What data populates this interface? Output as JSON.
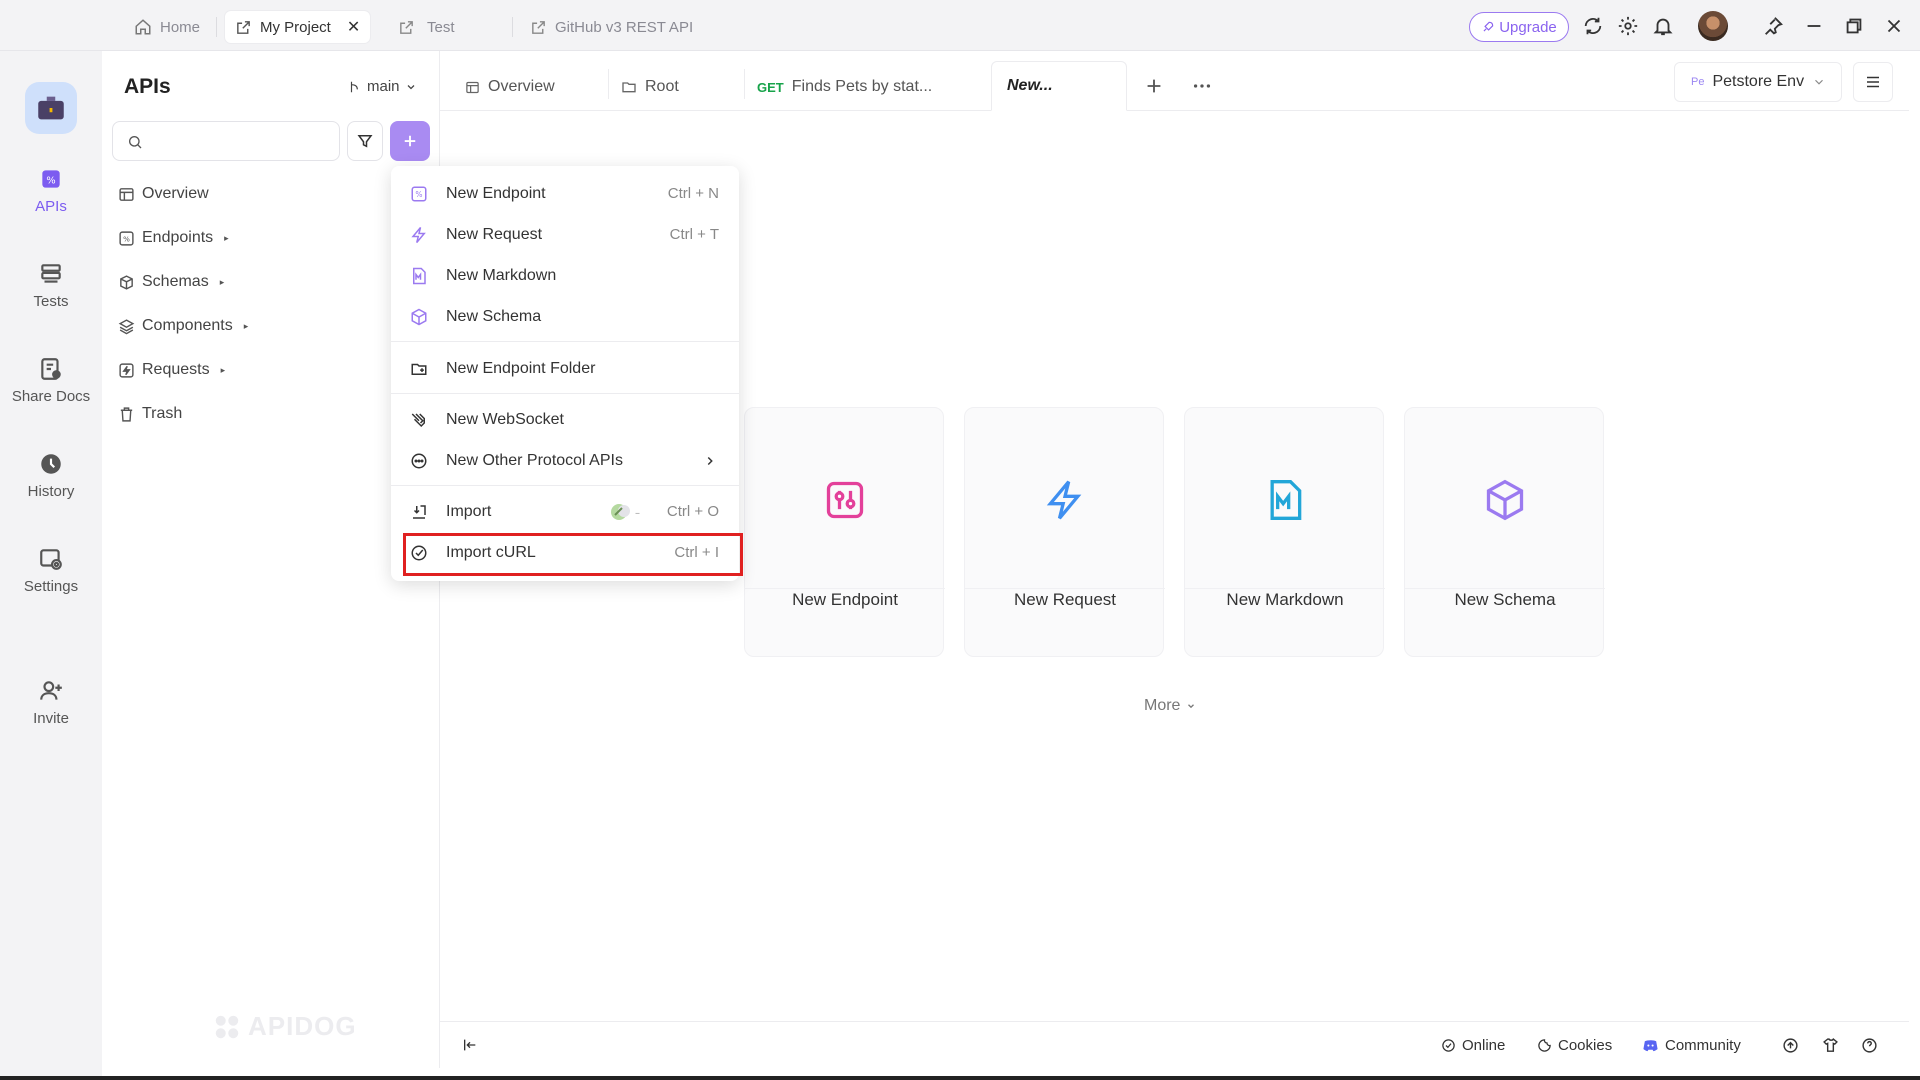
{
  "topbar": {
    "tabs": [
      {
        "label": "Home",
        "icon": "home-icon"
      },
      {
        "label": "My Project",
        "icon": "external-link-icon",
        "active": true
      },
      {
        "label": "Test",
        "icon": "external-link-icon"
      },
      {
        "label": "GitHub v3 REST API",
        "icon": "external-link-icon"
      }
    ],
    "close_glyph": "✕",
    "upgrade_label": "Upgrade",
    "window_controls": [
      "minimize",
      "restore",
      "close"
    ]
  },
  "rail": {
    "items": [
      {
        "label": "APIs",
        "icon": "api-icon",
        "active": true
      },
      {
        "label": "Tests",
        "icon": "tests-icon"
      },
      {
        "label": "Share Docs",
        "icon": "share-docs-icon"
      },
      {
        "label": "History",
        "icon": "history-icon"
      },
      {
        "label": "Settings",
        "icon": "settings-icon"
      },
      {
        "label": "Invite",
        "icon": "invite-icon"
      }
    ]
  },
  "sidepanel": {
    "title": "APIs",
    "branch": "main",
    "search_placeholder": "",
    "tree": [
      {
        "label": "Overview",
        "icon": "overview-icon",
        "caret": ""
      },
      {
        "label": "Endpoints",
        "icon": "endpoint-icon",
        "caret": "▸"
      },
      {
        "label": "Schemas",
        "icon": "schema-icon",
        "caret": "▸"
      },
      {
        "label": "Components",
        "icon": "components-icon",
        "caret": "▸"
      },
      {
        "label": "Requests",
        "icon": "request-icon",
        "caret": "▸"
      },
      {
        "label": "Trash",
        "icon": "trash-icon",
        "caret": ""
      }
    ],
    "watermark": "APIDOG"
  },
  "main": {
    "tabs": [
      {
        "label": "Overview",
        "icon": "overview-icon"
      },
      {
        "label": "Root",
        "icon": "folder-icon"
      },
      {
        "method": "GET",
        "label": "Finds Pets by stat..."
      }
    ],
    "active_tab": "New...",
    "env": {
      "badge": "Pe",
      "label": "Petstore Env"
    },
    "cards": [
      {
        "label": "New Endpoint",
        "icon": "endpoint-icon",
        "color": "#e3409a"
      },
      {
        "label": "New Request",
        "icon": "lightning-icon",
        "color": "#3f8ff0"
      },
      {
        "label": "New Markdown",
        "icon": "markdown-icon",
        "color": "#22a6d8"
      },
      {
        "label": "New Schema",
        "icon": "cube-icon",
        "color": "#9b7af0"
      }
    ],
    "more_label": "More",
    "bottombar": {
      "online": "Online",
      "cookies": "Cookies",
      "community": "Community"
    }
  },
  "menu": {
    "items": [
      {
        "label": "New Endpoint",
        "shortcut": "Ctrl + N",
        "icon": "endpoint-icon"
      },
      {
        "label": "New Request",
        "shortcut": "Ctrl + T",
        "icon": "lightning-icon"
      },
      {
        "label": "New Markdown",
        "shortcut": "",
        "icon": "markdown-icon"
      },
      {
        "label": "New Schema",
        "shortcut": "",
        "icon": "cube-icon"
      },
      {
        "label": "New Endpoint Folder",
        "shortcut": "",
        "icon": "folder-add-icon"
      },
      {
        "label": "New WebSocket",
        "shortcut": "",
        "icon": "websocket-icon"
      },
      {
        "label": "New Other Protocol APIs",
        "shortcut": "",
        "icon": "protocol-icon",
        "submenu": true
      },
      {
        "label": "Import",
        "shortcut": "Ctrl + O",
        "icon": "import-icon"
      },
      {
        "label": "Import cURL",
        "shortcut": "Ctrl + I",
        "icon": "curl-icon",
        "highlighted": true
      }
    ]
  },
  "colors": {
    "accent": "#8a63ef",
    "highlight_border": "#e02020",
    "get_method": "#17a34a"
  }
}
